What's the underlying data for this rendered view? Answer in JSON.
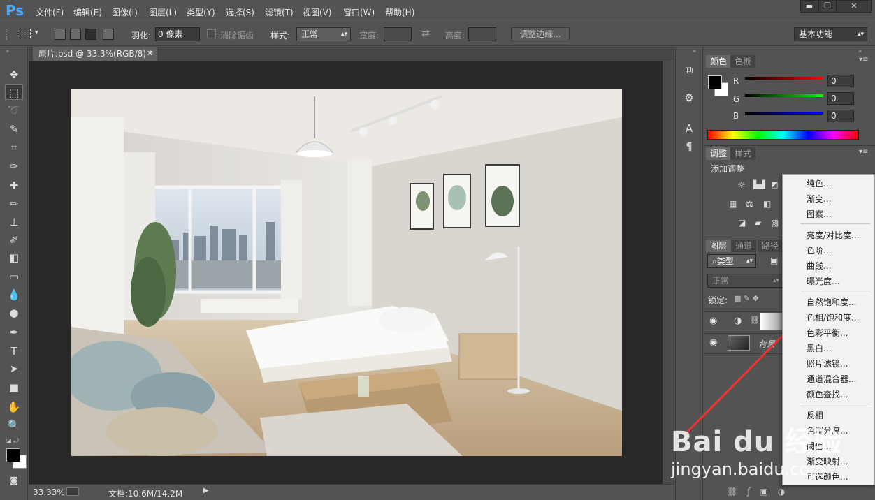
{
  "app": {
    "logo": "Ps"
  },
  "menubar": {
    "items": [
      "文件(F)",
      "编辑(E)",
      "图像(I)",
      "图层(L)",
      "类型(Y)",
      "选择(S)",
      "滤镜(T)",
      "视图(V)",
      "窗口(W)",
      "帮助(H)"
    ]
  },
  "window_controls": {
    "minimize": "▬",
    "restore": "❐",
    "close": "✕"
  },
  "options": {
    "feather_label": "羽化:",
    "feather_value": "0 像素",
    "antialias_label": "消除锯齿",
    "style_label": "样式:",
    "style_value": "正常",
    "width_label": "宽度:",
    "height_label": "高度:",
    "refine_button": "调整边缘...",
    "workspace": "基本功能"
  },
  "document": {
    "tab_title": "原片.psd @ 33.3%(RGB/8) *",
    "zoom": "33.33%",
    "doc_info": "文档:10.6M/14.2M"
  },
  "color_panel": {
    "tabs": [
      "颜色",
      "色板"
    ],
    "channels": [
      {
        "label": "R",
        "value": "0",
        "color": "#ff0000"
      },
      {
        "label": "G",
        "value": "0",
        "color": "#00ff00"
      },
      {
        "label": "B",
        "value": "0",
        "color": "#0000ff"
      }
    ]
  },
  "adjust_panel": {
    "tabs": [
      "调整",
      "样式"
    ],
    "title": "添加调整"
  },
  "layers_panel": {
    "tabs": [
      "图层",
      "通道",
      "路径"
    ],
    "filter": "类型",
    "blend": "正常",
    "lock_label": "锁定:",
    "layers": [
      {
        "name": ""
      },
      {
        "name": "背景"
      }
    ]
  },
  "context_menu": {
    "groups": [
      [
        "纯色...",
        "渐变...",
        "图案..."
      ],
      [
        "亮度/对比度...",
        "色阶...",
        "曲线...",
        "曝光度..."
      ],
      [
        "自然饱和度...",
        "色相/饱和度...",
        "色彩平衡...",
        "黑白...",
        "照片滤镜...",
        "通道混合器...",
        "颜色查找..."
      ],
      [
        "反相",
        "色调分离...",
        "阈值...",
        "渐变映射...",
        "可选颜色..."
      ]
    ]
  },
  "watermark": {
    "brand": "Bai du 经验",
    "url": "jingyan.baidu.com"
  },
  "annotation_color": "#ee3333"
}
